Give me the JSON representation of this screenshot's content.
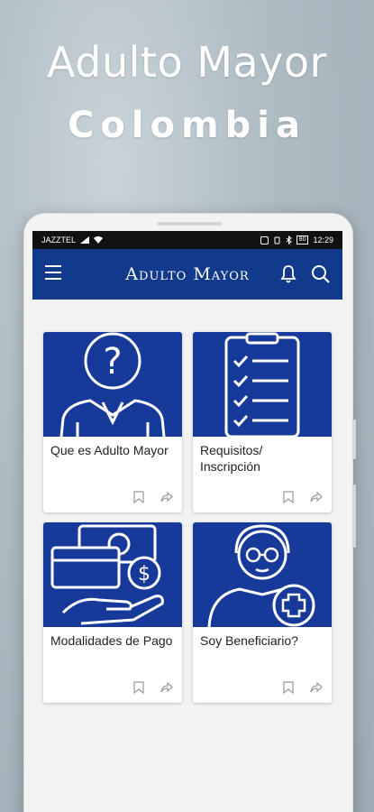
{
  "hero": {
    "title": "Adulto Mayor",
    "subtitle": "Colombia"
  },
  "statusbar": {
    "carrier": "JAZZTEL",
    "battery": "80",
    "time": "12:29"
  },
  "appbar": {
    "title": "Adulto Mayor"
  },
  "cards": [
    {
      "label": "Que es Adulto Mayor",
      "image_icon": "question-person-icon"
    },
    {
      "label": "Requisitos/ Inscripción",
      "image_icon": "checklist-icon"
    },
    {
      "label": "Modalidades de Pago",
      "image_icon": "payment-hand-icon"
    },
    {
      "label": "Soy Beneficiario?",
      "image_icon": "elder-health-icon"
    }
  ],
  "colors": {
    "primary": "#123a8c",
    "card_image_bg": "#17399a",
    "status_bar": "#111111"
  }
}
